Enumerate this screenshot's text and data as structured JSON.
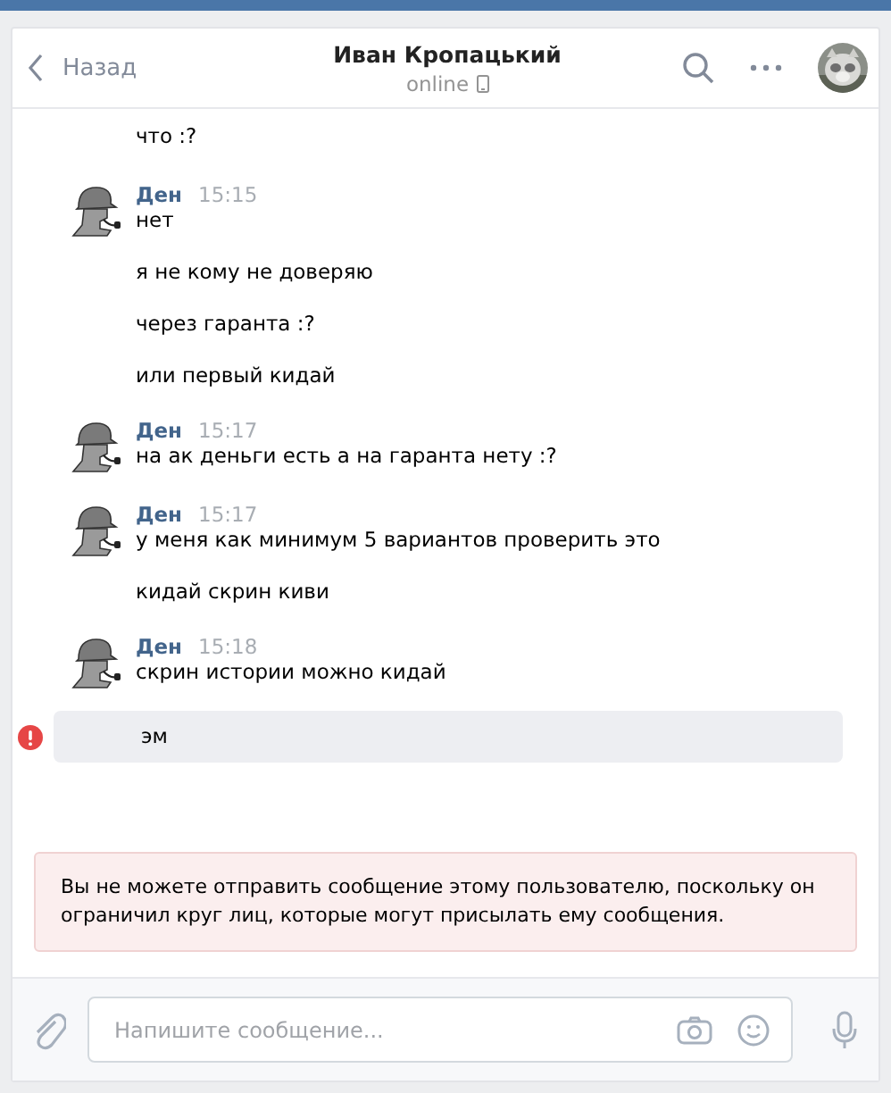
{
  "header": {
    "back": "Назад",
    "title": "Иван Кропацький",
    "status": "online"
  },
  "groups": [
    {
      "kind": "continued",
      "messages": [
        "что :?"
      ]
    },
    {
      "kind": "incoming",
      "author": "Ден",
      "time": "15:15",
      "messages": [
        "нет",
        "я не кому не доверяю",
        "через гаранта :?",
        "или первый кидай"
      ]
    },
    {
      "kind": "incoming",
      "author": "Ден",
      "time": "15:17",
      "messages": [
        "на ак деньги есть а на гаранта нету :?"
      ]
    },
    {
      "kind": "incoming",
      "author": "Ден",
      "time": "15:17",
      "messages": [
        "у меня как минимум 5 вариантов проверить это",
        "кидай скрин киви"
      ]
    },
    {
      "kind": "incoming",
      "author": "Ден",
      "time": "15:18",
      "messages": [
        "скрин истории можно кидай"
      ]
    },
    {
      "kind": "failed",
      "messages": [
        "эм"
      ]
    }
  ],
  "notice": "Вы не можете отправить сообщение этому пользователю, поскольку он ограничил круг лиц, которые могут присылать ему сообщения.",
  "composer": {
    "placeholder": "Напишите сообщение..."
  }
}
